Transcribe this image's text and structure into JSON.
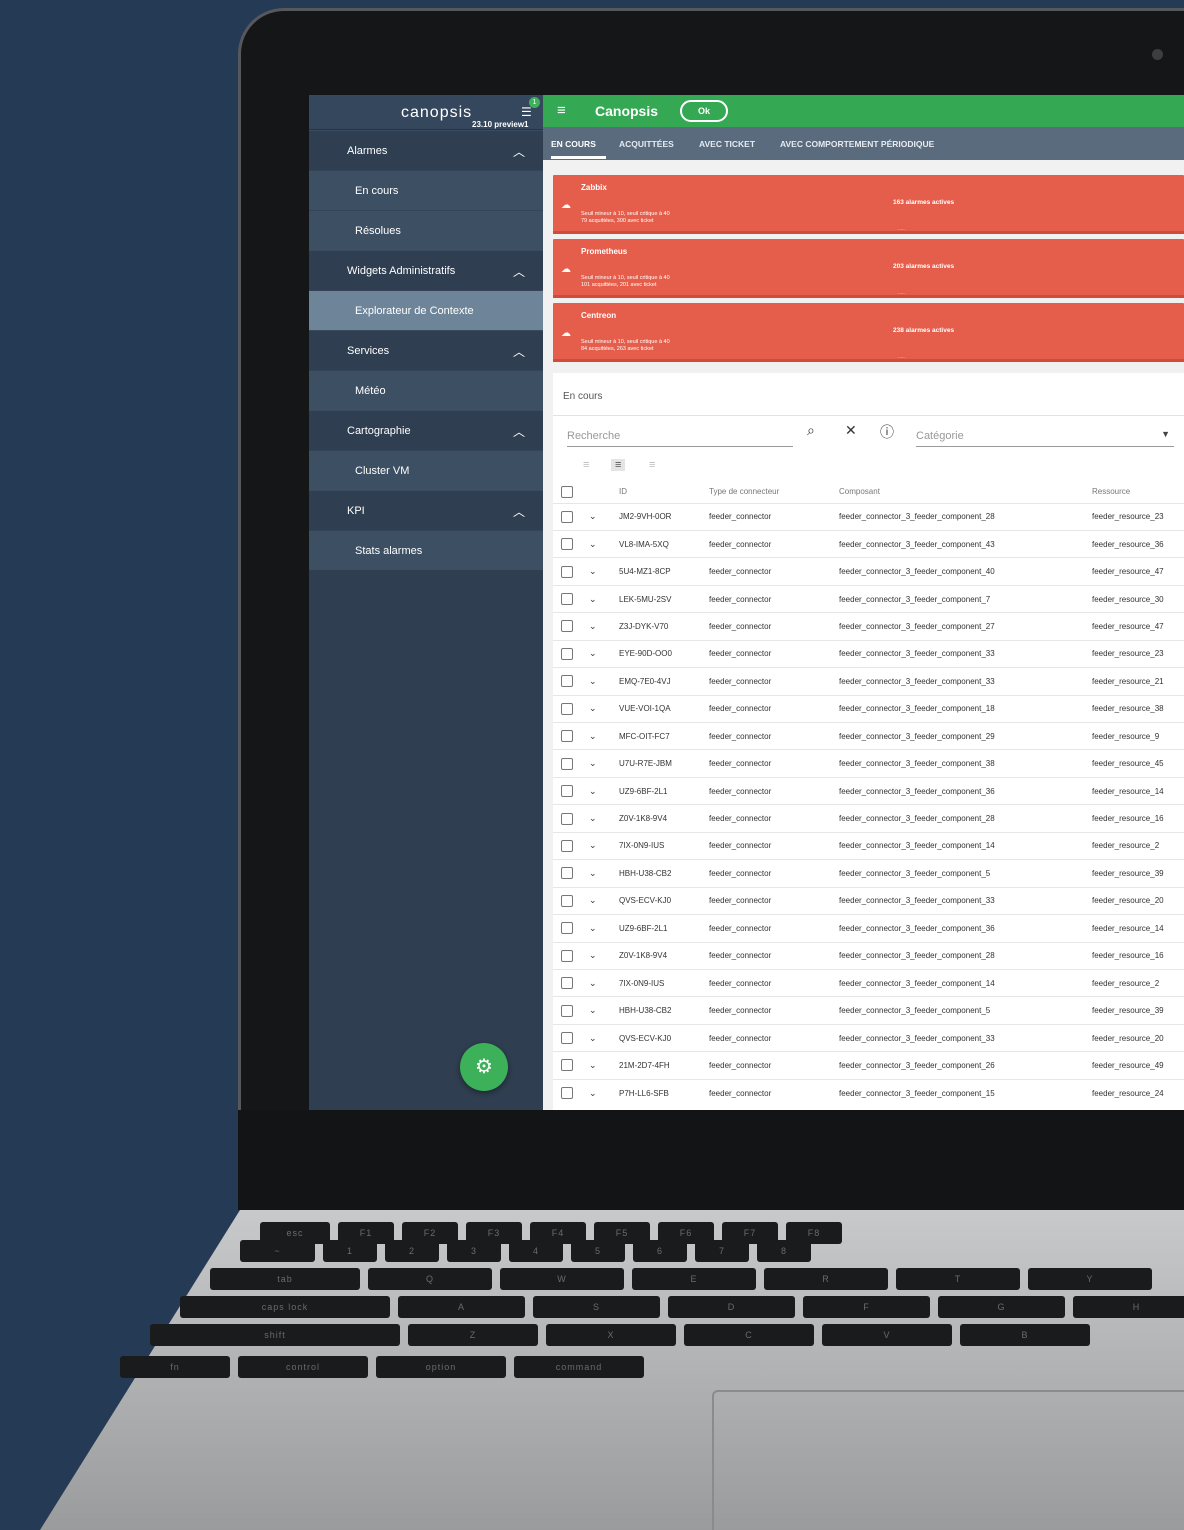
{
  "sidebar": {
    "logo": "canopsis",
    "version": "23.10 preview1",
    "notification_count": "1",
    "groups": [
      {
        "label": "Alarmes",
        "items": [
          "En cours",
          "Résolues"
        ]
      },
      {
        "label": "Widgets Administratifs",
        "items": [
          "Explorateur de Contexte"
        ]
      },
      {
        "label": "Services",
        "items": [
          "Météo"
        ]
      },
      {
        "label": "Cartographie",
        "items": [
          "Cluster VM"
        ]
      },
      {
        "label": "KPI",
        "items": [
          "Stats alarmes"
        ]
      }
    ],
    "active_item": "Explorateur de Contexte"
  },
  "topbar": {
    "title": "Canopsis",
    "status": "Ok"
  },
  "tabs": [
    "EN COURS",
    "ACQUITTÉES",
    "AVEC TICKET",
    "AVEC COMPORTEMENT PÉRIODIQUE"
  ],
  "cards": [
    {
      "name": "Zabbix",
      "count": "163 alarmes actives",
      "line1": "Seuil mineur à 10, seuil critique à 40",
      "line2": "79 acquittées, 300 avec ticket"
    },
    {
      "name": "Prometheus",
      "count": "203 alarmes actives",
      "line1": "Seuil mineur à 10, seuil critique à 40",
      "line2": "101 acquittées, 201 avec ticket"
    },
    {
      "name": "Centreon",
      "count": "238 alarmes actives",
      "line1": "Seuil mineur à 10, seuil critique à 40",
      "line2": "84 acquittées, 263 avec ticket"
    }
  ],
  "panel": {
    "title": "En cours",
    "search_placeholder": "Recherche",
    "category_label": "Catégorie",
    "columns": [
      "ID",
      "Type de connecteur",
      "Composant",
      "Ressource"
    ],
    "rows": [
      [
        "JM2-9VH-0OR",
        "feeder_connector",
        "feeder_connector_3_feeder_component_28",
        "feeder_resource_23"
      ],
      [
        "VL8-IMA-5XQ",
        "feeder_connector",
        "feeder_connector_3_feeder_component_43",
        "feeder_resource_36"
      ],
      [
        "5U4-MZ1-8CP",
        "feeder_connector",
        "feeder_connector_3_feeder_component_40",
        "feeder_resource_47"
      ],
      [
        "LEK-5MU-2SV",
        "feeder_connector",
        "feeder_connector_3_feeder_component_7",
        "feeder_resource_30"
      ],
      [
        "Z3J-DYK-V70",
        "feeder_connector",
        "feeder_connector_3_feeder_component_27",
        "feeder_resource_47"
      ],
      [
        "EYE-90D-OO0",
        "feeder_connector",
        "feeder_connector_3_feeder_component_33",
        "feeder_resource_23"
      ],
      [
        "EMQ-7E0-4VJ",
        "feeder_connector",
        "feeder_connector_3_feeder_component_33",
        "feeder_resource_21"
      ],
      [
        "VUE-VOI-1QA",
        "feeder_connector",
        "feeder_connector_3_feeder_component_18",
        "feeder_resource_38"
      ],
      [
        "MFC-OIT-FC7",
        "feeder_connector",
        "feeder_connector_3_feeder_component_29",
        "feeder_resource_9"
      ],
      [
        "U7U-R7E-JBM",
        "feeder_connector",
        "feeder_connector_3_feeder_component_38",
        "feeder_resource_45"
      ],
      [
        "UZ9-6BF-2L1",
        "feeder_connector",
        "feeder_connector_3_feeder_component_36",
        "feeder_resource_14"
      ],
      [
        "Z0V-1K8-9V4",
        "feeder_connector",
        "feeder_connector_3_feeder_component_28",
        "feeder_resource_16"
      ],
      [
        "7IX-0N9-IUS",
        "feeder_connector",
        "feeder_connector_3_feeder_component_14",
        "feeder_resource_2"
      ],
      [
        "HBH-U38-CB2",
        "feeder_connector",
        "feeder_connector_3_feeder_component_5",
        "feeder_resource_39"
      ],
      [
        "QVS-ECV-KJ0",
        "feeder_connector",
        "feeder_connector_3_feeder_component_33",
        "feeder_resource_20"
      ],
      [
        "UZ9-6BF-2L1",
        "feeder_connector",
        "feeder_connector_3_feeder_component_36",
        "feeder_resource_14"
      ],
      [
        "Z0V-1K8-9V4",
        "feeder_connector",
        "feeder_connector_3_feeder_component_28",
        "feeder_resource_16"
      ],
      [
        "7IX-0N9-IUS",
        "feeder_connector",
        "feeder_connector_3_feeder_component_14",
        "feeder_resource_2"
      ],
      [
        "HBH-U38-CB2",
        "feeder_connector",
        "feeder_connector_3_feeder_component_5",
        "feeder_resource_39"
      ],
      [
        "QVS-ECV-KJ0",
        "feeder_connector",
        "feeder_connector_3_feeder_component_33",
        "feeder_resource_20"
      ],
      [
        "21M-2D7-4FH",
        "feeder_connector",
        "feeder_connector_3_feeder_component_26",
        "feeder_resource_49"
      ],
      [
        "P7H-LL6-SFB",
        "feeder_connector",
        "feeder_connector_3_feeder_component_15",
        "feeder_resource_24"
      ]
    ]
  },
  "keyboard": {
    "row0": [
      "esc",
      "F1",
      "F2",
      "F3",
      "F4",
      "F5",
      "F6",
      "F7",
      "F8"
    ],
    "row1": [
      "~",
      "1",
      "2",
      "3",
      "4",
      "5",
      "6",
      "7",
      "8"
    ],
    "row2": [
      "tab",
      "Q",
      "W",
      "E",
      "R",
      "T",
      "Y"
    ],
    "row3": [
      "caps lock",
      "A",
      "S",
      "D",
      "F",
      "G",
      "H"
    ],
    "row4": [
      "shift",
      "Z",
      "X",
      "C",
      "V",
      "B"
    ],
    "row5": [
      "fn",
      "control",
      "option",
      "command"
    ]
  },
  "colors": {
    "accent_green": "#34a853",
    "alarm_red": "#e55e4b",
    "sidebar": "#2f3e50",
    "background": "#253a55"
  }
}
